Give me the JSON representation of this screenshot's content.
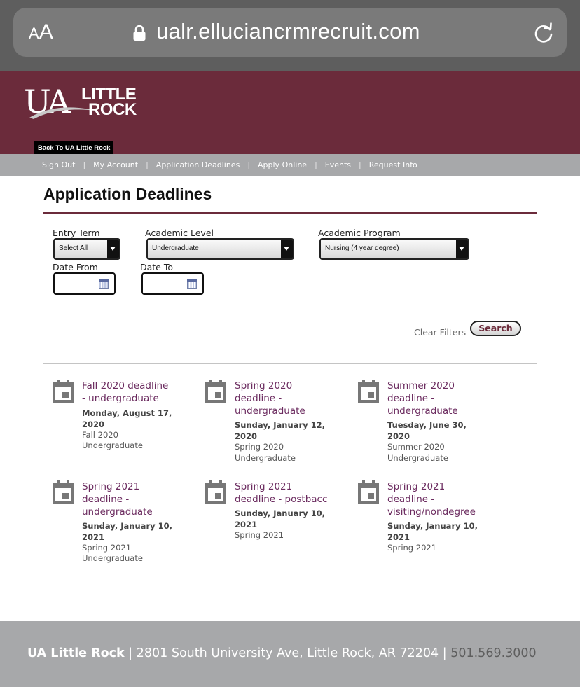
{
  "browser": {
    "aa_small": "A",
    "aa_big": "A",
    "url": "ualr.elluciancrmrecruit.com",
    "icons": {
      "lock": "lock-icon",
      "reload": "reload-icon"
    }
  },
  "header": {
    "logo_ua": "UA",
    "logo_line1": "LITTLE",
    "logo_line2": "ROCK",
    "back_button": "Back To UA Little Rock",
    "brand_color": "#6b2b3b"
  },
  "nav": {
    "items": [
      "Sign Out",
      "My Account",
      "Application Deadlines",
      "Apply Online",
      "Events",
      "Request Info"
    ],
    "separator": "|"
  },
  "page": {
    "title": "Application Deadlines"
  },
  "filters": {
    "entry_term": {
      "label": "Entry Term",
      "value": "Select All"
    },
    "academic_level": {
      "label": "Academic Level",
      "value": "Undergraduate"
    },
    "academic_program": {
      "label": "Academic Program",
      "value": "Nursing (4 year degree)"
    },
    "date_from": {
      "label": "Date From",
      "value": ""
    },
    "date_to": {
      "label": "Date To",
      "value": ""
    },
    "clear_label": "Clear Filters",
    "search_label": "Search"
  },
  "events": [
    {
      "title": "Fall 2020 deadline - undergraduate",
      "date": "Monday, August 17, 2020",
      "term": "Fall 2020",
      "level": "Undergraduate"
    },
    {
      "title": "Spring 2020 deadline - undergraduate",
      "date": "Sunday, January 12, 2020",
      "term": "Spring 2020",
      "level": "Undergraduate"
    },
    {
      "title": "Summer 2020 deadline - undergraduate",
      "date": "Tuesday, June 30, 2020",
      "term": "Summer 2020",
      "level": "Undergraduate"
    },
    {
      "title": "Spring 2021 deadline - undergraduate",
      "date": "Sunday, January 10, 2021",
      "term": "Spring 2021",
      "level": "Undergraduate"
    },
    {
      "title": "Spring 2021 deadline - postbacc",
      "date": "Sunday, January 10, 2021",
      "term": "Spring 2021",
      "level": ""
    },
    {
      "title": "Spring 2021 deadline - visiting/nondegree",
      "date": "Sunday, January 10, 2021",
      "term": "Spring 2021",
      "level": ""
    }
  ],
  "footer": {
    "name": "UA Little Rock",
    "sep": "|",
    "address": "2801 South University Ave, Little Rock, AR 72204",
    "phone": "501.569.3000"
  }
}
